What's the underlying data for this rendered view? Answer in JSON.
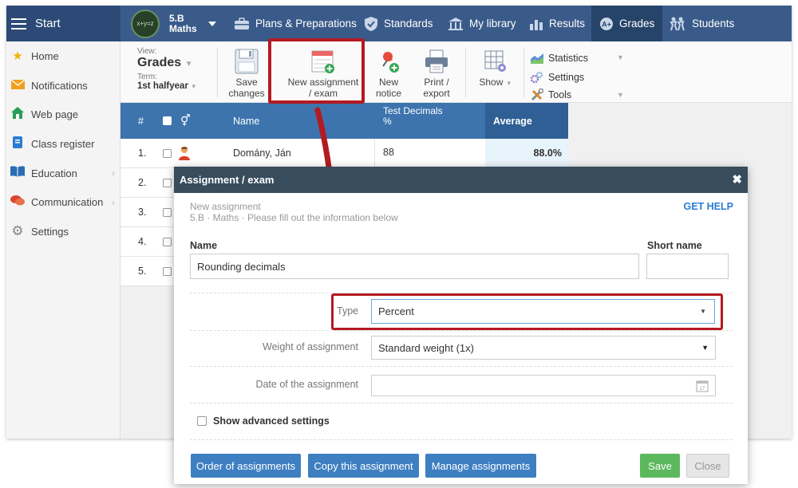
{
  "topbar": {
    "start_label": "Start",
    "class_name": "5.B",
    "class_subject": "Maths",
    "avatar_text": "x+y=z",
    "nav": [
      {
        "label": "Plans & Preparations",
        "icon": "briefcase-icon"
      },
      {
        "label": "Standards",
        "icon": "shield-icon"
      },
      {
        "label": "My library",
        "icon": "library-icon"
      },
      {
        "label": "Results",
        "icon": "bar-chart-icon"
      },
      {
        "label": "Grades",
        "icon": "grades-icon"
      },
      {
        "label": "Students",
        "icon": "students-icon"
      }
    ]
  },
  "sidebar": {
    "items": [
      {
        "label": "Home",
        "icon": "star-icon"
      },
      {
        "label": "Notifications",
        "icon": "envelope-icon"
      },
      {
        "label": "Web page",
        "icon": "house-icon"
      },
      {
        "label": "Class register",
        "icon": "register-icon"
      },
      {
        "label": "Education",
        "icon": "book-icon"
      },
      {
        "label": "Communication",
        "icon": "chat-icon"
      },
      {
        "label": "Settings",
        "icon": "gear-icon"
      }
    ]
  },
  "toolbar": {
    "view_label": "View:",
    "view_value": "Grades",
    "term_label": "Term:",
    "term_value": "1st halfyear",
    "save_line1": "Save",
    "save_line2": "changes",
    "new_assignment_line1": "New assignment",
    "new_assignment_line2": "/ exam",
    "new_notice_line1": "New",
    "new_notice_line2": "notice",
    "print_line1": "Print /",
    "print_line2": "export",
    "show_label": "Show",
    "statistics_label": "Statistics",
    "settings_label": "Settings",
    "tools_label": "Tools"
  },
  "table": {
    "col_num": "#",
    "col_name": "Name",
    "col_test": "Test Decimals",
    "col_test_unit": "%",
    "col_avg": "Average",
    "rows": [
      {
        "num": "1.",
        "name": "Domány, Ján",
        "score": "88",
        "avg": "88.0%"
      },
      {
        "num": "2."
      },
      {
        "num": "3."
      },
      {
        "num": "4."
      },
      {
        "num": "5."
      }
    ]
  },
  "modal": {
    "title": "Assignment / exam",
    "subtitle1": "New assignment",
    "subtitle2": "5.B · Maths · Please fill out the information below",
    "get_help": "GET HELP",
    "name_label": "Name",
    "name_value": "Rounding decimals",
    "short_name_label": "Short name",
    "short_name_value": "",
    "type_label": "Type",
    "type_value": "Percent",
    "weight_label": "Weight of assignment",
    "weight_value": "Standard weight (1x)",
    "date_label": "Date of the assignment",
    "date_value": "",
    "advanced_label": "Show advanced settings",
    "btn_order": "Order of assignments",
    "btn_copy": "Copy this assignment",
    "btn_manage": "Manage assignments",
    "btn_save": "Save",
    "btn_close": "Close"
  },
  "colors": {
    "topbar": "#3a5b8a",
    "table_header": "#3d74ad",
    "highlight": "#b31a22",
    "save_green": "#5cb85c",
    "button_blue": "#3e7fc1"
  }
}
